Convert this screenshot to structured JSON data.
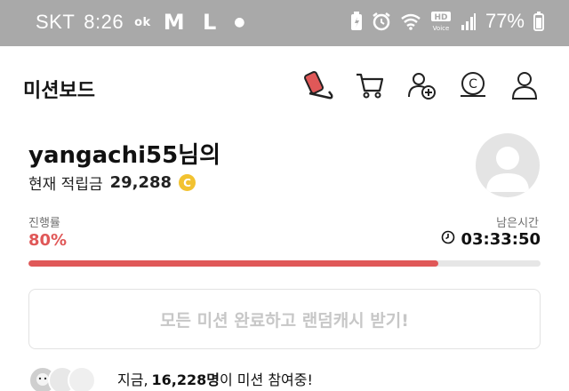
{
  "status_bar": {
    "carrier": "SKT",
    "time": "8:26",
    "network_badge": "ok",
    "network_letters": "M L",
    "battery_percent": "77%",
    "hd_label": "HD",
    "voice_label": "Voice",
    "icons": [
      "battery-saver-icon",
      "alarm-icon",
      "wifi-icon",
      "hd-voice-icon",
      "signal-icon",
      "battery-icon"
    ]
  },
  "header": {
    "title": "미션보드",
    "icons": [
      "sneaker-icon",
      "cart-icon",
      "add-user-icon",
      "cash-coin-icon",
      "profile-icon"
    ]
  },
  "profile": {
    "username": "yangachi55님의",
    "points_label": "현재 적립금",
    "points_value": "29,288",
    "coin_symbol": "C"
  },
  "progress": {
    "label": "진행률",
    "value_text": "80%",
    "fraction": 0.8,
    "remaining_label": "남은시간",
    "remaining_time": "03:33:50"
  },
  "reward_button": {
    "label": "모든 미션 완료하고 랜덤캐시 받기!"
  },
  "participants": {
    "prefix": "지금,",
    "count": "16,228명",
    "suffix": "이 미션 참여중!"
  },
  "colors": {
    "accent": "#e05858",
    "status_bar_bg": "#a9a9a9",
    "coin": "#f2c230",
    "disabled_text": "#c7c7c7"
  }
}
